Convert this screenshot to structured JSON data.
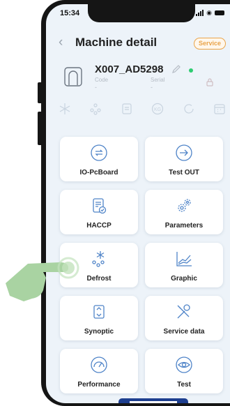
{
  "status_bar": {
    "time": "15:34"
  },
  "header": {
    "title": "Machine detail",
    "badge": "Service"
  },
  "machine": {
    "id": "X007_AD5298",
    "code_label": "Code",
    "code_value": "-",
    "serial_label": "Serial",
    "serial_value": "-",
    "status_color": "#2ecc71"
  },
  "status_icons": [
    "snowflake-icon",
    "droplets-icon",
    "doc-icon",
    "kg-icon",
    "cycle-icon",
    "calendar-icon"
  ],
  "tiles": [
    {
      "label": "IO-PcBoard",
      "icon": "io-exchange-icon"
    },
    {
      "label": "Test OUT",
      "icon": "arrow-out-icon"
    },
    {
      "label": "HACCP",
      "icon": "document-check-icon"
    },
    {
      "label": "Parameters",
      "icon": "gears-icon"
    },
    {
      "label": "Defrost",
      "icon": "defrost-icon"
    },
    {
      "label": "Graphic",
      "icon": "graph-icon"
    },
    {
      "label": "Synoptic",
      "icon": "synoptic-icon"
    },
    {
      "label": "Service data",
      "icon": "tools-icon"
    },
    {
      "label": "Performance",
      "icon": "gauge-icon"
    },
    {
      "label": "Test",
      "icon": "eye-icon"
    }
  ],
  "colors": {
    "accent": "#4f84c8",
    "badge": "#e9a44a",
    "hand": "#a9d3a2"
  }
}
